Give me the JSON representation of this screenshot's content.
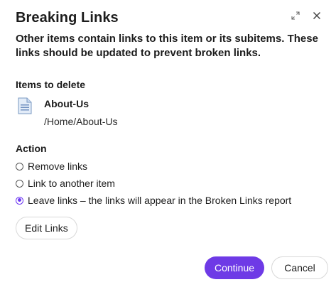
{
  "dialog": {
    "title": "Breaking Links",
    "subtitle": "Other items contain links to this item or its subitems. These links should be updated to prevent broken links."
  },
  "items_section": {
    "heading": "Items to delete",
    "items": [
      {
        "name": "About-Us",
        "path": "/Home/About-Us",
        "icon": "document-icon"
      }
    ]
  },
  "action_section": {
    "heading": "Action",
    "options": [
      {
        "label": "Remove links",
        "selected": false
      },
      {
        "label": "Link to another item",
        "selected": false
      },
      {
        "label": "Leave links – the links will appear in the Broken Links report",
        "selected": true
      }
    ]
  },
  "buttons": {
    "edit_links": "Edit Links",
    "continue": "Continue",
    "cancel": "Cancel"
  },
  "colors": {
    "accent": "#6e3ae6",
    "radio_selected": "#6d37f3"
  }
}
